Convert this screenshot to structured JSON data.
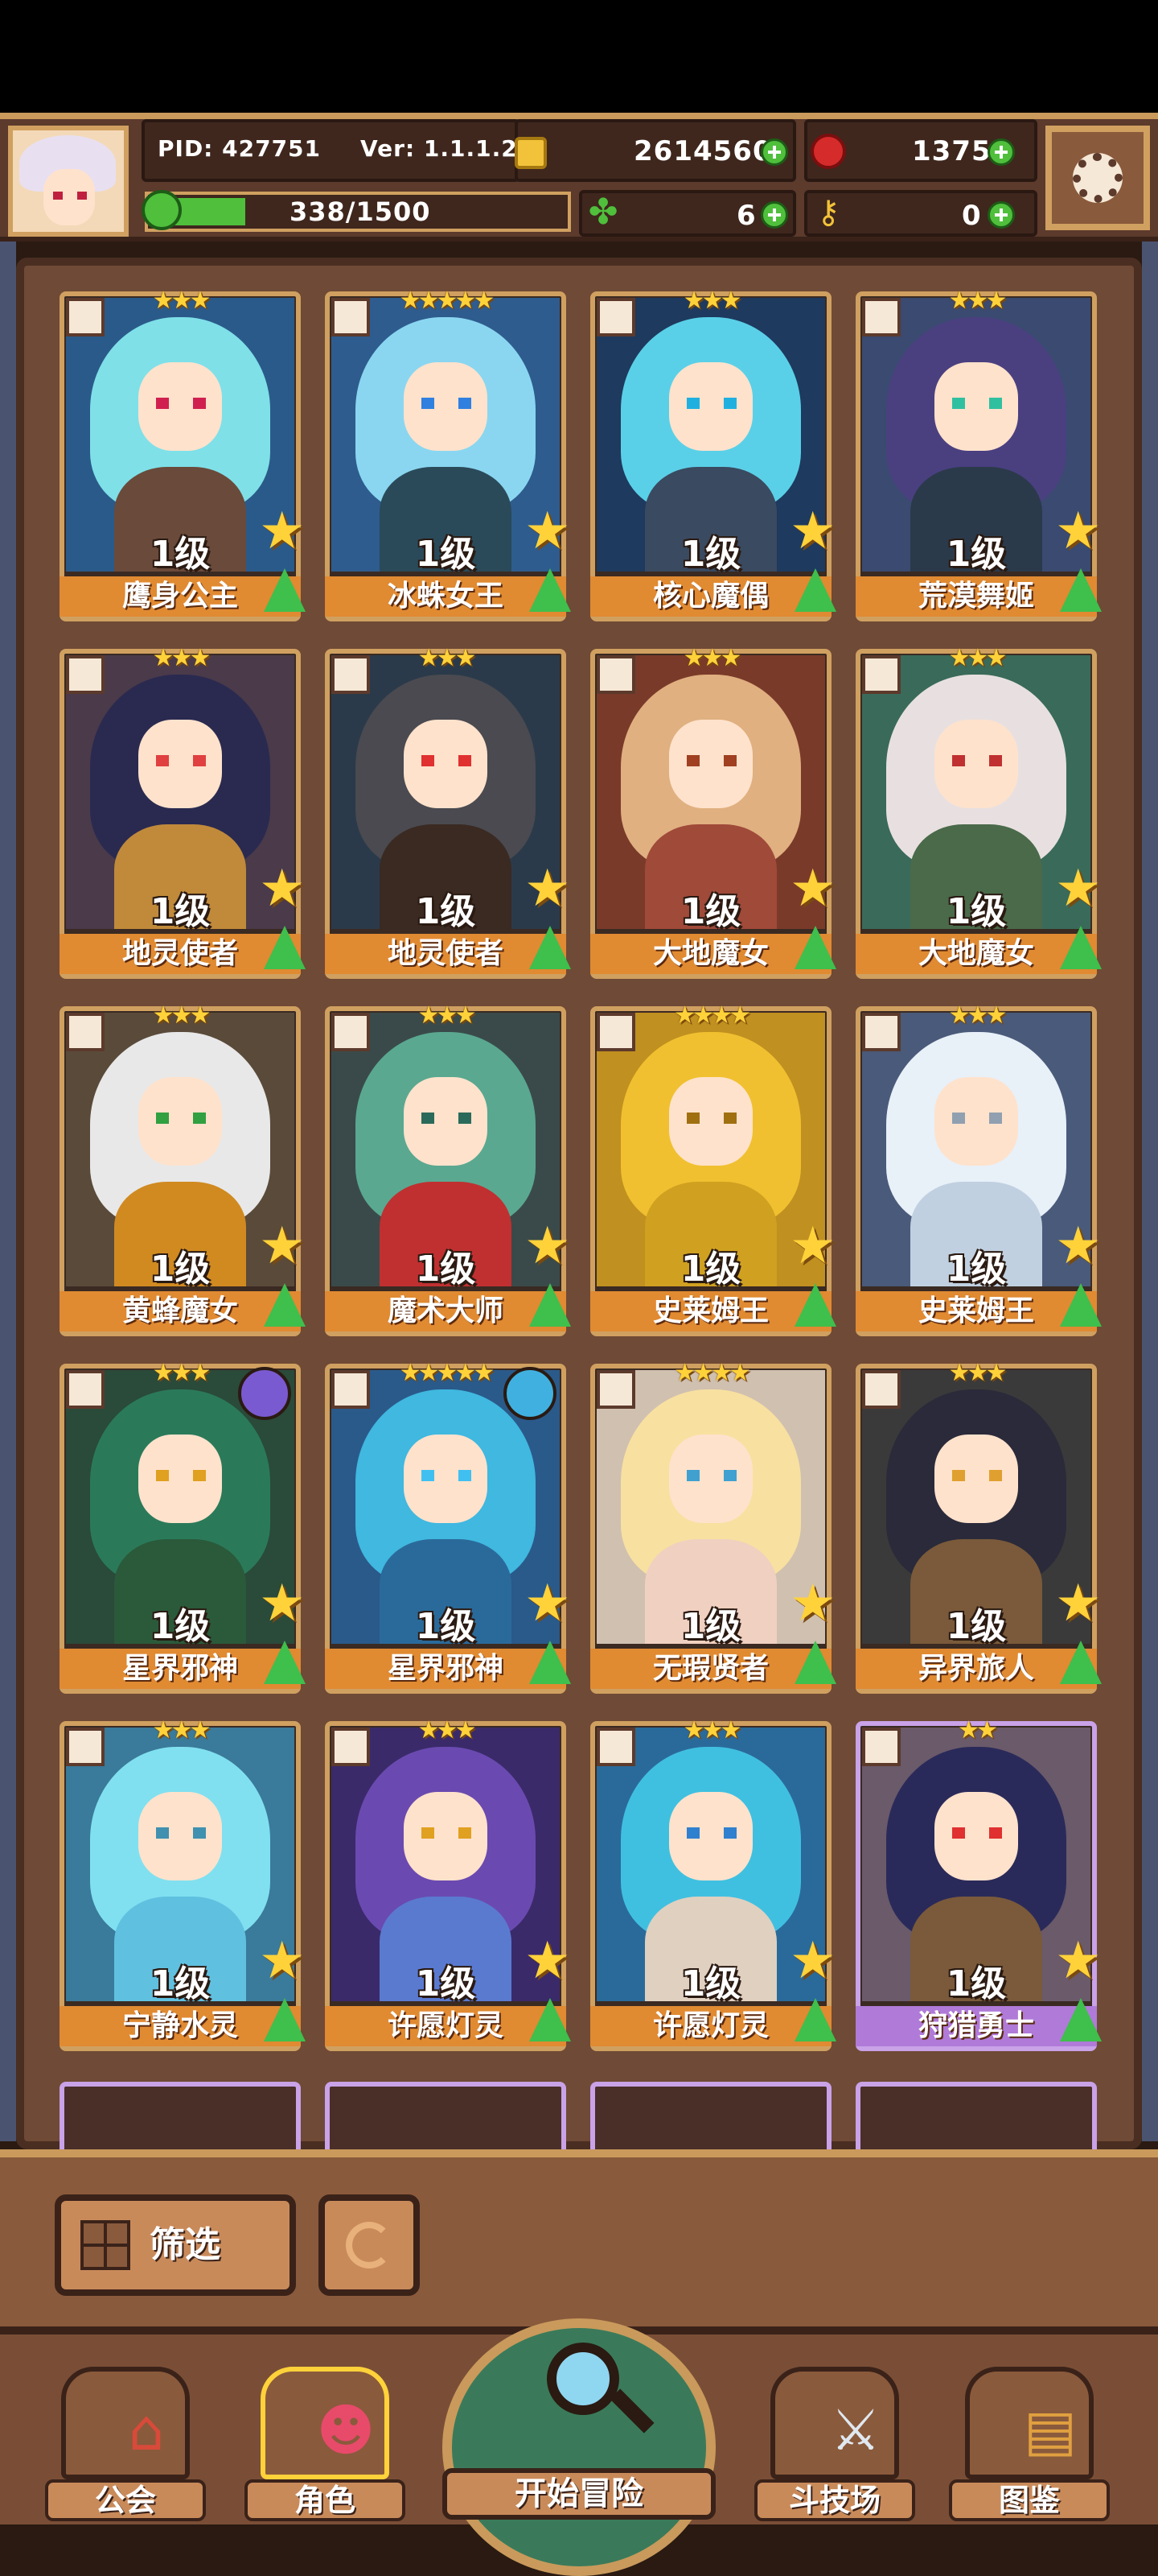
{
  "header": {
    "pid": "PID: 427751",
    "version": "Ver: 1.1.1.2",
    "gold": "2614560",
    "gems": "1375",
    "energy": "338/1500",
    "energy_fraction": 0.225,
    "clovers": "6",
    "keys": "0"
  },
  "cards": [
    {
      "name": "鹰身公主",
      "level": "1级",
      "stars": "★★★",
      "hair": "#7fe0e8",
      "body": "#6a4a3a",
      "eyes": "#d02050",
      "bg": "#2a5a8a",
      "elem": "",
      "purple": false
    },
    {
      "name": "冰蛛女王",
      "level": "1级",
      "stars": "★★★★★",
      "hair": "#8ad6f0",
      "body": "#2a4a5a",
      "eyes": "#3080e0",
      "bg": "#2e5c8e",
      "elem": "",
      "purple": false
    },
    {
      "name": "核心魔偶",
      "level": "1级",
      "stars": "★★★",
      "hair": "#5ad0e8",
      "body": "#3a4a60",
      "eyes": "#20b0e0",
      "bg": "#1e3a5e",
      "elem": "",
      "purple": false
    },
    {
      "name": "荒漠舞姬",
      "level": "1级",
      "stars": "★★★",
      "hair": "#4a4080",
      "body": "#2a3a4a",
      "eyes": "#30c0a0",
      "bg": "#3a4a70",
      "elem": "",
      "purple": false
    },
    {
      "name": "地灵使者",
      "level": "1级",
      "stars": "★★★",
      "hair": "#2a2a50",
      "body": "#c08a3a",
      "eyes": "#e04040",
      "bg": "#4a3a4a",
      "elem": "",
      "purple": false
    },
    {
      "name": "地灵使者",
      "level": "1级",
      "stars": "★★★",
      "hair": "#4a4a50",
      "body": "#3a2a22",
      "eyes": "#e03030",
      "bg": "#2a3a4a",
      "elem": "",
      "purple": false
    },
    {
      "name": "大地魔女",
      "level": "1级",
      "stars": "★★★",
      "hair": "#e0b080",
      "body": "#a04a3a",
      "eyes": "#a04020",
      "bg": "#7a3a2a",
      "elem": "",
      "purple": false
    },
    {
      "name": "大地魔女",
      "level": "1级",
      "stars": "★★★",
      "hair": "#e8e0e0",
      "body": "#4a6a4a",
      "eyes": "#c03030",
      "bg": "#3a6a5a",
      "elem": "",
      "purple": false
    },
    {
      "name": "黄蜂魔女",
      "level": "1级",
      "stars": "★★★",
      "hair": "#e8e8e8",
      "body": "#d08a20",
      "eyes": "#30a040",
      "bg": "#5a4a3a",
      "elem": "",
      "purple": false
    },
    {
      "name": "魔术大师",
      "level": "1级",
      "stars": "★★★",
      "hair": "#5aa890",
      "body": "#c03030",
      "eyes": "#2a6a5a",
      "bg": "#3a4a4a",
      "elem": "",
      "purple": false
    },
    {
      "name": "史莱姆王",
      "level": "1级",
      "stars": "★★★★",
      "hair": "#f0c030",
      "body": "#d0a020",
      "eyes": "#a07010",
      "bg": "#c09020",
      "elem": "",
      "purple": false
    },
    {
      "name": "史莱姆王",
      "level": "1级",
      "stars": "★★★",
      "hair": "#e8f0f8",
      "body": "#c0d0e0",
      "eyes": "#90a0b0",
      "bg": "#4a5a7a",
      "elem": "",
      "purple": false
    },
    {
      "name": "星界邪神",
      "level": "1级",
      "stars": "★★★",
      "hair": "#2a7a5a",
      "body": "#2a5a3a",
      "eyes": "#e0a020",
      "bg": "#2a4a3a",
      "elem": "#7a5ad0",
      "purple": false
    },
    {
      "name": "星界邪神",
      "level": "1级",
      "stars": "★★★★★",
      "hair": "#40b8e0",
      "body": "#2a6a9a",
      "eyes": "#40c0f0",
      "bg": "#2a5a8a",
      "elem": "#40b0e0",
      "purple": false
    },
    {
      "name": "无瑕贤者",
      "level": "1级",
      "stars": "★★★★",
      "hair": "#f8e0a0",
      "body": "#f0d0c0",
      "eyes": "#40a0d0",
      "bg": "#d0c0b0",
      "elem": "",
      "purple": false
    },
    {
      "name": "异界旅人",
      "level": "1级",
      "stars": "★★★",
      "hair": "#2a2a3a",
      "body": "#7a5a3a",
      "eyes": "#e0a030",
      "bg": "#3a3a3a",
      "elem": "",
      "purple": false
    },
    {
      "name": "宁静水灵",
      "level": "1级",
      "stars": "★★★",
      "hair": "#80e0f0",
      "body": "#60c0e0",
      "eyes": "#4090b0",
      "bg": "#3a7a9a",
      "elem": "",
      "purple": false
    },
    {
      "name": "许愿灯灵",
      "level": "1级",
      "stars": "★★★",
      "hair": "#6a4ab0",
      "body": "#5a7ad0",
      "eyes": "#e0a020",
      "bg": "#3a2a6a",
      "elem": "",
      "purple": false
    },
    {
      "name": "许愿灯灵",
      "level": "1级",
      "stars": "★★★",
      "hair": "#40c0e0",
      "body": "#e0d0c0",
      "eyes": "#3080d0",
      "bg": "#2a6a9a",
      "elem": "",
      "purple": false
    },
    {
      "name": "狩猎勇士",
      "level": "1级",
      "stars": "★★",
      "hair": "#2a2a5a",
      "body": "#7a5a3a",
      "eyes": "#e03030",
      "bg": "#6a5a6a",
      "elem": "",
      "purple": true
    }
  ],
  "filter": {
    "label": "筛选"
  },
  "nav": {
    "guild": "公会",
    "character": "角色",
    "adventure": "开始冒险",
    "arena": "斗技场",
    "codex": "图鉴"
  }
}
